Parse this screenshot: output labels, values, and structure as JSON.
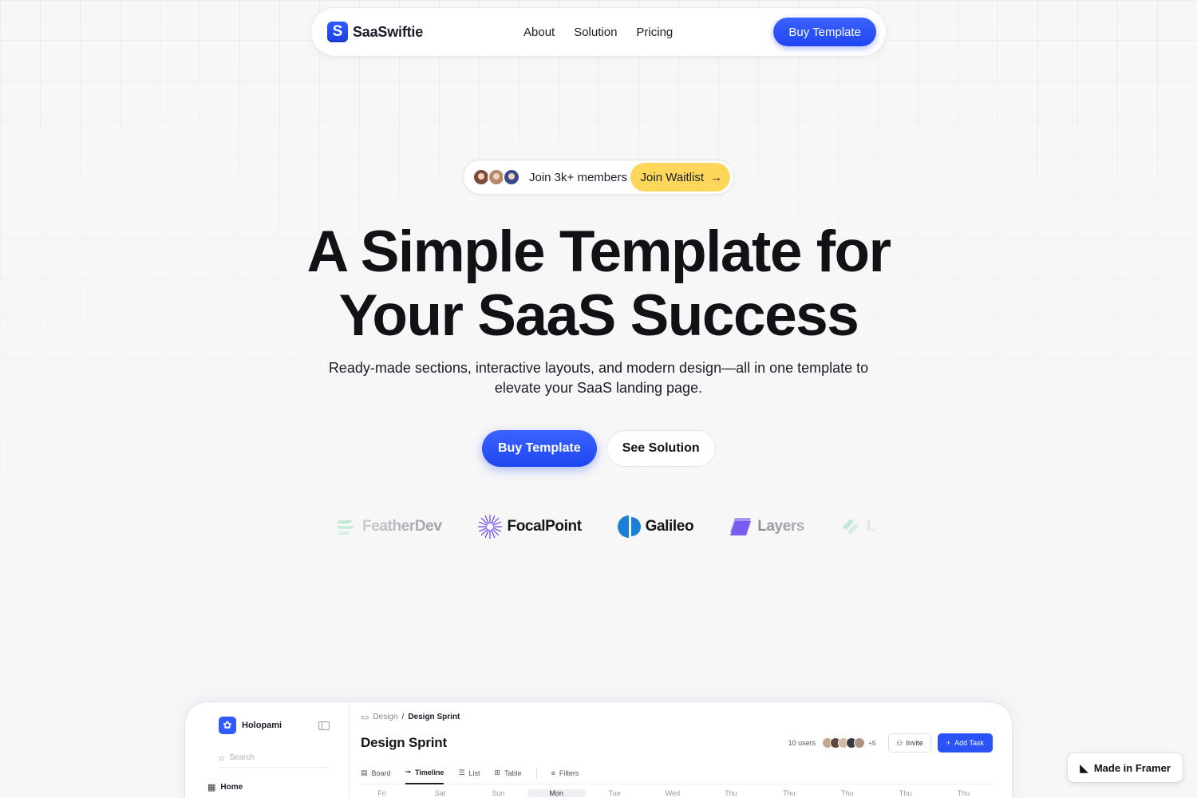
{
  "nav": {
    "brand": "SaaSwiftie",
    "brand_logo_letter": "S",
    "links": [
      "About",
      "Solution",
      "Pricing"
    ],
    "cta": "Buy Template"
  },
  "badge_pill": {
    "text": "Join 3k+ members",
    "button": "Join Waitlist",
    "avatar_colors": [
      "#7a4a3a",
      "#b58a6a",
      "#3b4a8a"
    ]
  },
  "hero": {
    "title_line1": "A Simple Template for",
    "title_line2": "Your SaaS Success",
    "subtitle_line1": "Ready-made sections, interactive layouts, and modern design—all in one template to",
    "subtitle_line2": "elevate your SaaS landing page.",
    "primary_button": "Buy Template",
    "secondary_button": "See Solution"
  },
  "logos": [
    {
      "name": "FeatherDev",
      "icon": "feather-lines-icon",
      "color": "#4ec98a"
    },
    {
      "name": "FocalPoint",
      "icon": "starburst-icon",
      "color": "#6a3ef0"
    },
    {
      "name": "Galileo",
      "icon": "half-circle-icon",
      "color": "#1a7fd6"
    },
    {
      "name": "Layers",
      "icon": "layers-icon",
      "color": "#7b5cf0"
    },
    {
      "name": "L",
      "icon": "leaf-icon",
      "color": "#4ec98a"
    }
  ],
  "app": {
    "brand": "Holopami",
    "search_placeholder": "Search",
    "home": "Home",
    "breadcrumb_parent": "Design",
    "breadcrumb_sep": "/",
    "breadcrumb_current": "Design Sprint",
    "title": "Design Sprint",
    "users_count": "10 users",
    "more_users": "+5",
    "invite": "Invite",
    "add_task": "Add Task",
    "tabs": [
      "Board",
      "Timeline",
      "List",
      "Table",
      "Filters"
    ],
    "active_tab": "Timeline",
    "days": [
      "Fri",
      "Sat",
      "Sun",
      "Mon",
      "Tue",
      "Wed",
      "Thu",
      "Thu",
      "Thu",
      "Thu",
      "Thu"
    ]
  },
  "framer_badge": "Made in Framer",
  "colors": {
    "accent": "#2a52f5",
    "yellow": "#fdd75a",
    "background": "#f7f7f8"
  }
}
